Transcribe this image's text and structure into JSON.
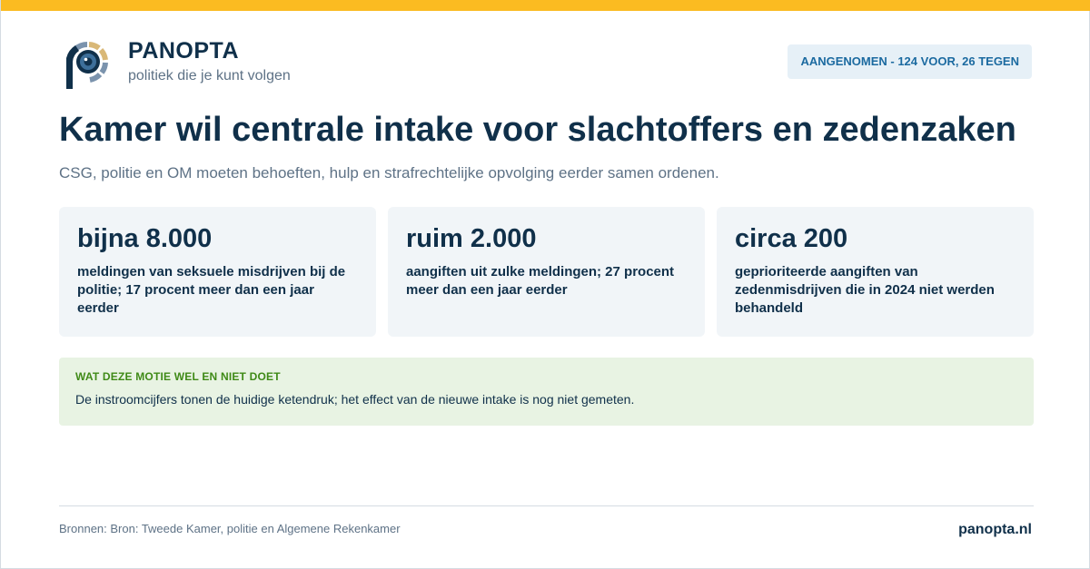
{
  "colors": {
    "accent_bar": "#fbbb21",
    "navy": "#10304a",
    "muted": "#5e7286",
    "badge_bg": "#e6f0f7",
    "badge_text": "#1b6aa0",
    "card_bg": "#f1f5f8",
    "note_bg": "#e8f3e3",
    "note_title": "#3f8a17",
    "logo_ring_gold": "#d9b877",
    "logo_ring_blue": "#7b93ad",
    "logo_eye": "#3d6f9a"
  },
  "brand": {
    "logo_icon": "panopta-eye-logo-icon",
    "name": "PANOPTA",
    "tagline": "politiek die je kunt volgen"
  },
  "status_badge": "AANGENOMEN - 124 VOOR, 26 TEGEN",
  "headline": "Kamer wil centrale intake voor slachtoffers en zedenzaken",
  "subhead": "CSG, politie en OM moeten behoeften, hulp en strafrechtelijke opvolging eerder samen ordenen.",
  "stats": [
    {
      "value": "bijna 8.000",
      "description": "meldingen van seksuele misdrijven bij de politie; 17 procent meer dan een jaar eerder"
    },
    {
      "value": "ruim 2.000",
      "description": "aangiften uit zulke meldingen; 27 procent meer dan een jaar eerder"
    },
    {
      "value": "circa 200",
      "description": "geprioriteerde aangiften van zedenmisdrijven die in 2024 niet werden behandeld"
    }
  ],
  "note": {
    "title": "WAT DEZE MOTIE WEL EN NIET DOET",
    "body": "De instroomcijfers tonen de huidige ketendruk; het effect van de nieuwe intake is nog niet gemeten."
  },
  "footer": {
    "sources": "Bronnen: Bron: Tweede Kamer, politie en Algemene Rekenkamer",
    "site": "panopta.nl"
  }
}
